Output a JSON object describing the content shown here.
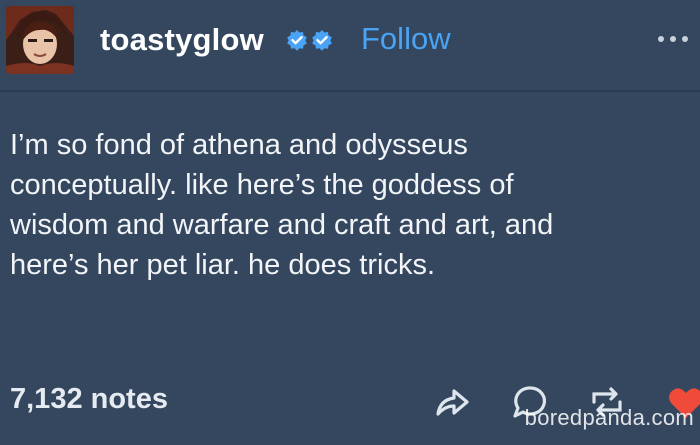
{
  "post": {
    "username": "toastyglow",
    "follow_label": "Follow",
    "body": "I’m so fond of athena and odysseus\nconceptually.  like here’s the goddess of\nwisdom and warfare and craft and art, and\nhere’s her pet liar.  he does tricks.",
    "notes": "7,132 notes"
  },
  "icons": {
    "avatar": "avatar-image",
    "verified_badge": "check-badge-icon",
    "more": "more-options-icon",
    "share": "share-icon",
    "reply": "reply-icon",
    "reblog": "reblog-icon",
    "like": "heart-icon"
  },
  "colors": {
    "background": "#34475f",
    "follow": "#4aa3f4",
    "badge": "#4aa3f4",
    "heart": "#f04a3a"
  },
  "watermark": {
    "text": "boredpanda.com"
  }
}
